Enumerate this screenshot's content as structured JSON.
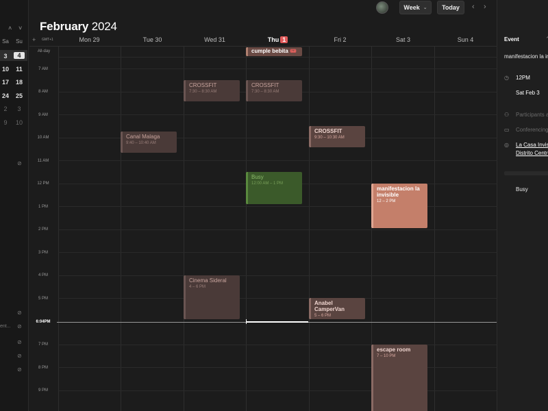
{
  "sidebar": {
    "chevron_up": "˄",
    "chevron_down": "˅",
    "weekday_headers": [
      "Sa",
      "Su"
    ],
    "weeks": [
      [
        "3",
        "4"
      ],
      [
        "10",
        "11"
      ],
      [
        "17",
        "18"
      ],
      [
        "24",
        "25"
      ],
      [
        "2",
        "3"
      ],
      [
        "9",
        "10"
      ]
    ],
    "clipped_label": "ent..."
  },
  "header": {
    "month": "February",
    "year": "2024",
    "view_label": "Week",
    "today_label": "Today",
    "prev": "‹",
    "next": "›"
  },
  "days": [
    {
      "label": "Mon 29"
    },
    {
      "label": "Tue 30"
    },
    {
      "label": "Wed 31"
    },
    {
      "label": "Thu",
      "badge": "1"
    },
    {
      "label": "Fri 2"
    },
    {
      "label": "Sat 3"
    },
    {
      "label": "Sun 4"
    }
  ],
  "timezone_label": "GMT+1",
  "allday_label": "All-day",
  "hours": [
    "7 AM",
    "8 AM",
    "9 AM",
    "10 AM",
    "11 AM",
    "12 PM",
    "1 PM",
    "2 PM",
    "3 PM",
    "4 PM",
    "5 PM",
    "",
    "7 PM",
    "8 PM",
    "9 PM"
  ],
  "now_label": "6:04PM",
  "events": {
    "allday_cumple": {
      "title": "cumple bebita 🎟️"
    },
    "crossfit_wed": {
      "title": "CROSSFIT",
      "time": "7:30 – 8:30 AM"
    },
    "crossfit_thu": {
      "title": "CROSSFIT",
      "time": "7:30 – 8:30 AM"
    },
    "crossfit_fri": {
      "title": "CROSSFIT",
      "time": "9:30 – 10:30 AM"
    },
    "canal_malaga": {
      "title": "Canal Malaga",
      "time": "9:40 – 10:40 AM"
    },
    "busy_thu": {
      "title": "Busy",
      "time": "12:00 AM – 1 PM"
    },
    "manifestacion": {
      "title": "manifestacion la invisible",
      "time": "12 – 2 PM"
    },
    "cinema": {
      "title": "Cinema Sideral",
      "time": "4 – 6 PM"
    },
    "anabel": {
      "title": "Anabel CamperVan",
      "time": "5 – 6 PM"
    },
    "escape": {
      "title": "escape room",
      "time": "7 – 10 PM"
    }
  },
  "panel": {
    "heading": "Event",
    "title": "manifestacion la invisible",
    "time": "12PM",
    "date": "Sat Feb 3",
    "participants": "Participants and",
    "conferencing": "Conferencing",
    "location_line1": "La Casa Invisible",
    "location_line2": "Distrito Centro",
    "status": "Busy"
  },
  "colors": {
    "background": "#1c1c1c",
    "accent_badge": "#e05a5a",
    "highlight_event": "#c47f6a",
    "green_event": "#3b5a2a"
  }
}
